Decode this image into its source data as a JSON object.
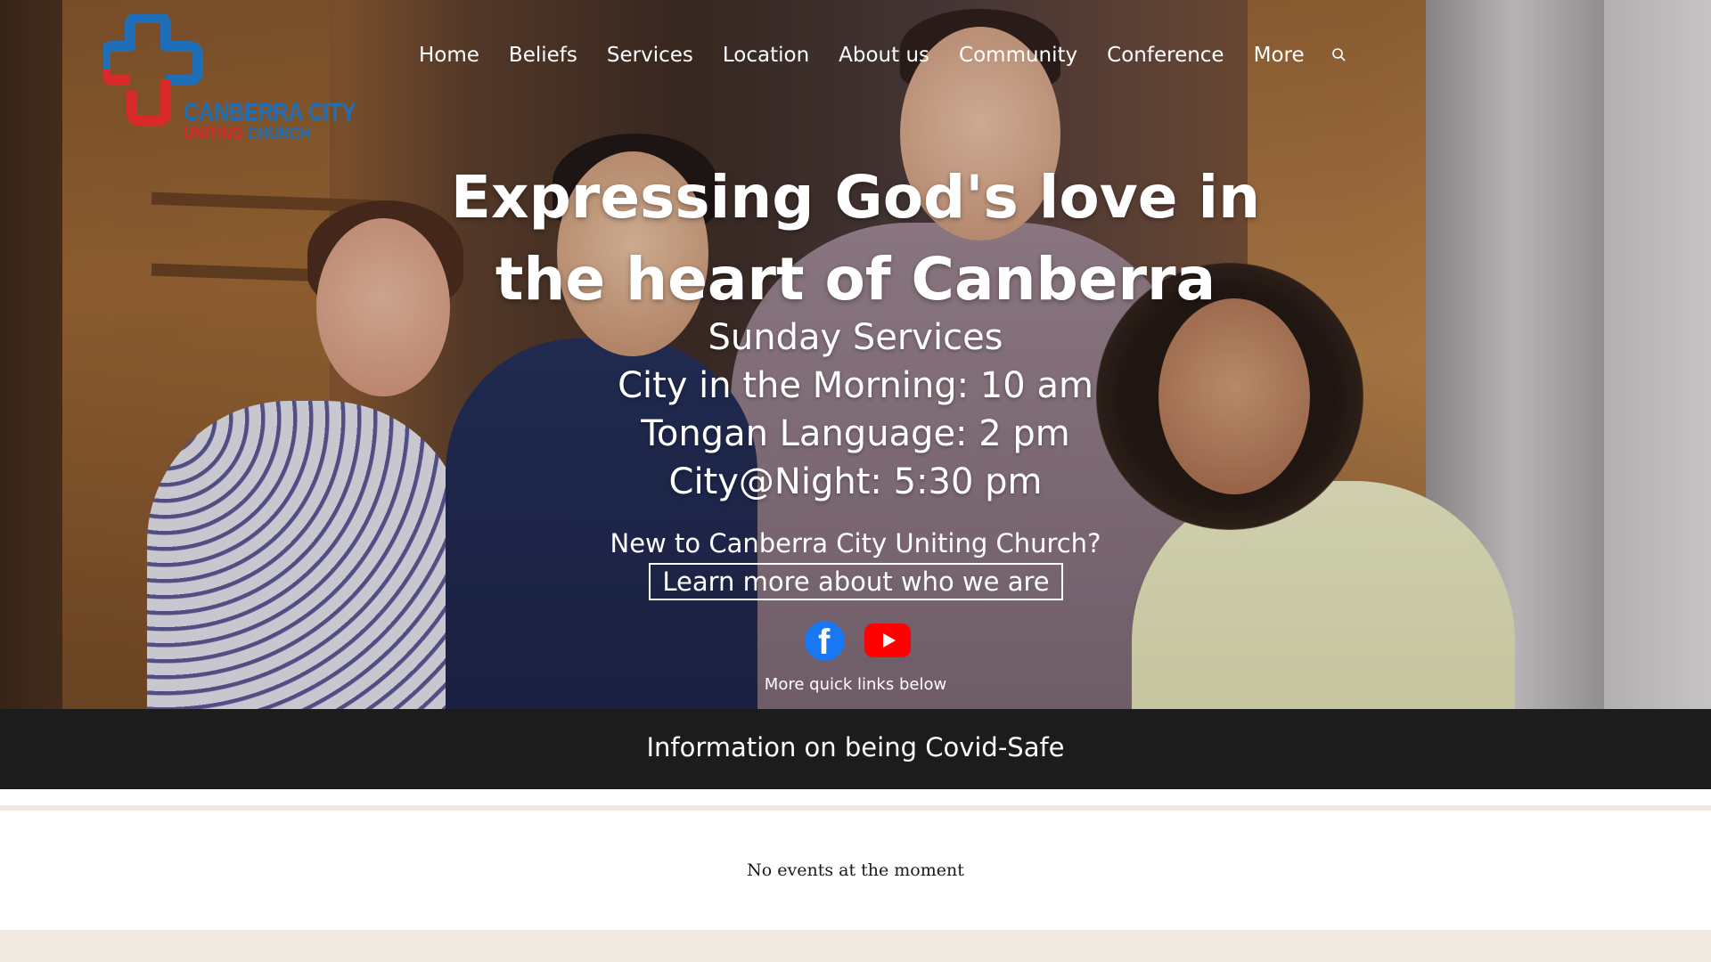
{
  "site": {
    "logo": {
      "line1": "CANBERRA CITY",
      "line2_part1": "UNITING",
      "line2_part2": "CHURCH",
      "colors": {
        "blue": "#1f6fb8",
        "red": "#d92a2a"
      }
    }
  },
  "nav": {
    "items": [
      {
        "label": "Home"
      },
      {
        "label": "Beliefs"
      },
      {
        "label": "Services"
      },
      {
        "label": "Location"
      },
      {
        "label": "About us"
      },
      {
        "label": "Community"
      },
      {
        "label": "Conference"
      },
      {
        "label": "More"
      }
    ],
    "search_icon": "search-icon"
  },
  "hero": {
    "headline": "Expressing God's love in the heart of Canberra",
    "services_title": "Sunday Services",
    "service_lines": [
      "City in the Morning: 10 am",
      "Tongan Language: 2 pm",
      "City@Night: 5:30 pm"
    ],
    "new_to": "New to Canberra City Uniting Church?",
    "learn_more": "Learn more about who we are",
    "social": {
      "facebook_icon": "facebook-icon",
      "youtube_icon": "youtube-icon",
      "facebook_color": "#1877f2",
      "youtube_color": "#ff0000"
    },
    "quick_links": "More quick links below"
  },
  "covid": {
    "label": "Information on being Covid-Safe",
    "background": "#1c1c1c"
  },
  "events": {
    "empty_text": "No events at the moment"
  },
  "colors": {
    "page_bg": "#efe9df"
  }
}
